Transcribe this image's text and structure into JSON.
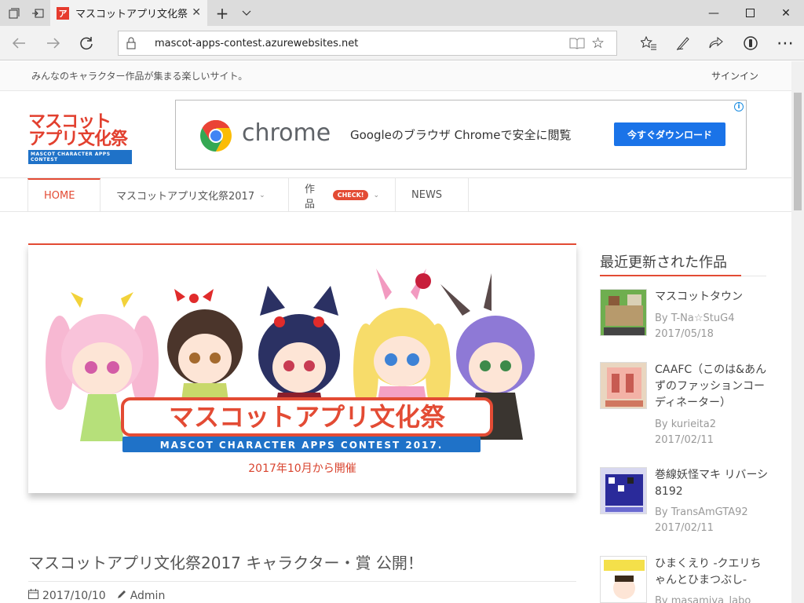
{
  "browser": {
    "tab_title": "マスコットアプリ文化祭",
    "tab_favicon": "ア",
    "url": "mascot-apps-contest.azurewebsites.net"
  },
  "site": {
    "tagline": "みんなのキャラクター作品が集まる楽しいサイト。",
    "signin": "サインイン",
    "logo_line1": "マスコット",
    "logo_line2": "アプリ文化祭",
    "logo_sub": "MASCOT CHARACTER APPS CONTEST"
  },
  "ad": {
    "brand": "chrome",
    "text": "Googleのブラウザ Chromeで安全に閲覧",
    "button": "今すぐダウンロード",
    "info": "i"
  },
  "menu": {
    "items": [
      {
        "label": "HOME"
      },
      {
        "label": "マスコットアプリ文化祭2017"
      },
      {
        "label": "作品",
        "badge": "CHECK!"
      },
      {
        "label": "NEWS"
      }
    ]
  },
  "hero": {
    "title_art": "マスコットアプリ文化祭",
    "subtitle_art": "MASCOT CHARACTER APPS CONTEST 2017.",
    "caption": "2017年10月から開催"
  },
  "post": {
    "title": "マスコットアプリ文化祭2017 キャラクター・賞 公開！",
    "date": "2017/10/10",
    "author": "Admin"
  },
  "sidebar": {
    "title": "最近更新された作品",
    "items": [
      {
        "name": "マスコットタウン",
        "by": "By T-Na☆StuG4",
        "date": "2017/05/18"
      },
      {
        "name": "CAAFC（このは&あんずのファッションコーディネーター）",
        "by": "By kurieita2",
        "date": "2017/02/11"
      },
      {
        "name": "巻線妖怪マキ リバーシ 8192",
        "by": "By TransAmGTA92",
        "date": "2017/02/11"
      },
      {
        "name": "ひまくえり -クエリちゃんとひまつぶし-",
        "by": "By masamiya_labo",
        "date": ""
      }
    ]
  },
  "colors": {
    "accent": "#e34b34",
    "ad_button": "#1a73e8",
    "logo_blue": "#1f72c8"
  }
}
